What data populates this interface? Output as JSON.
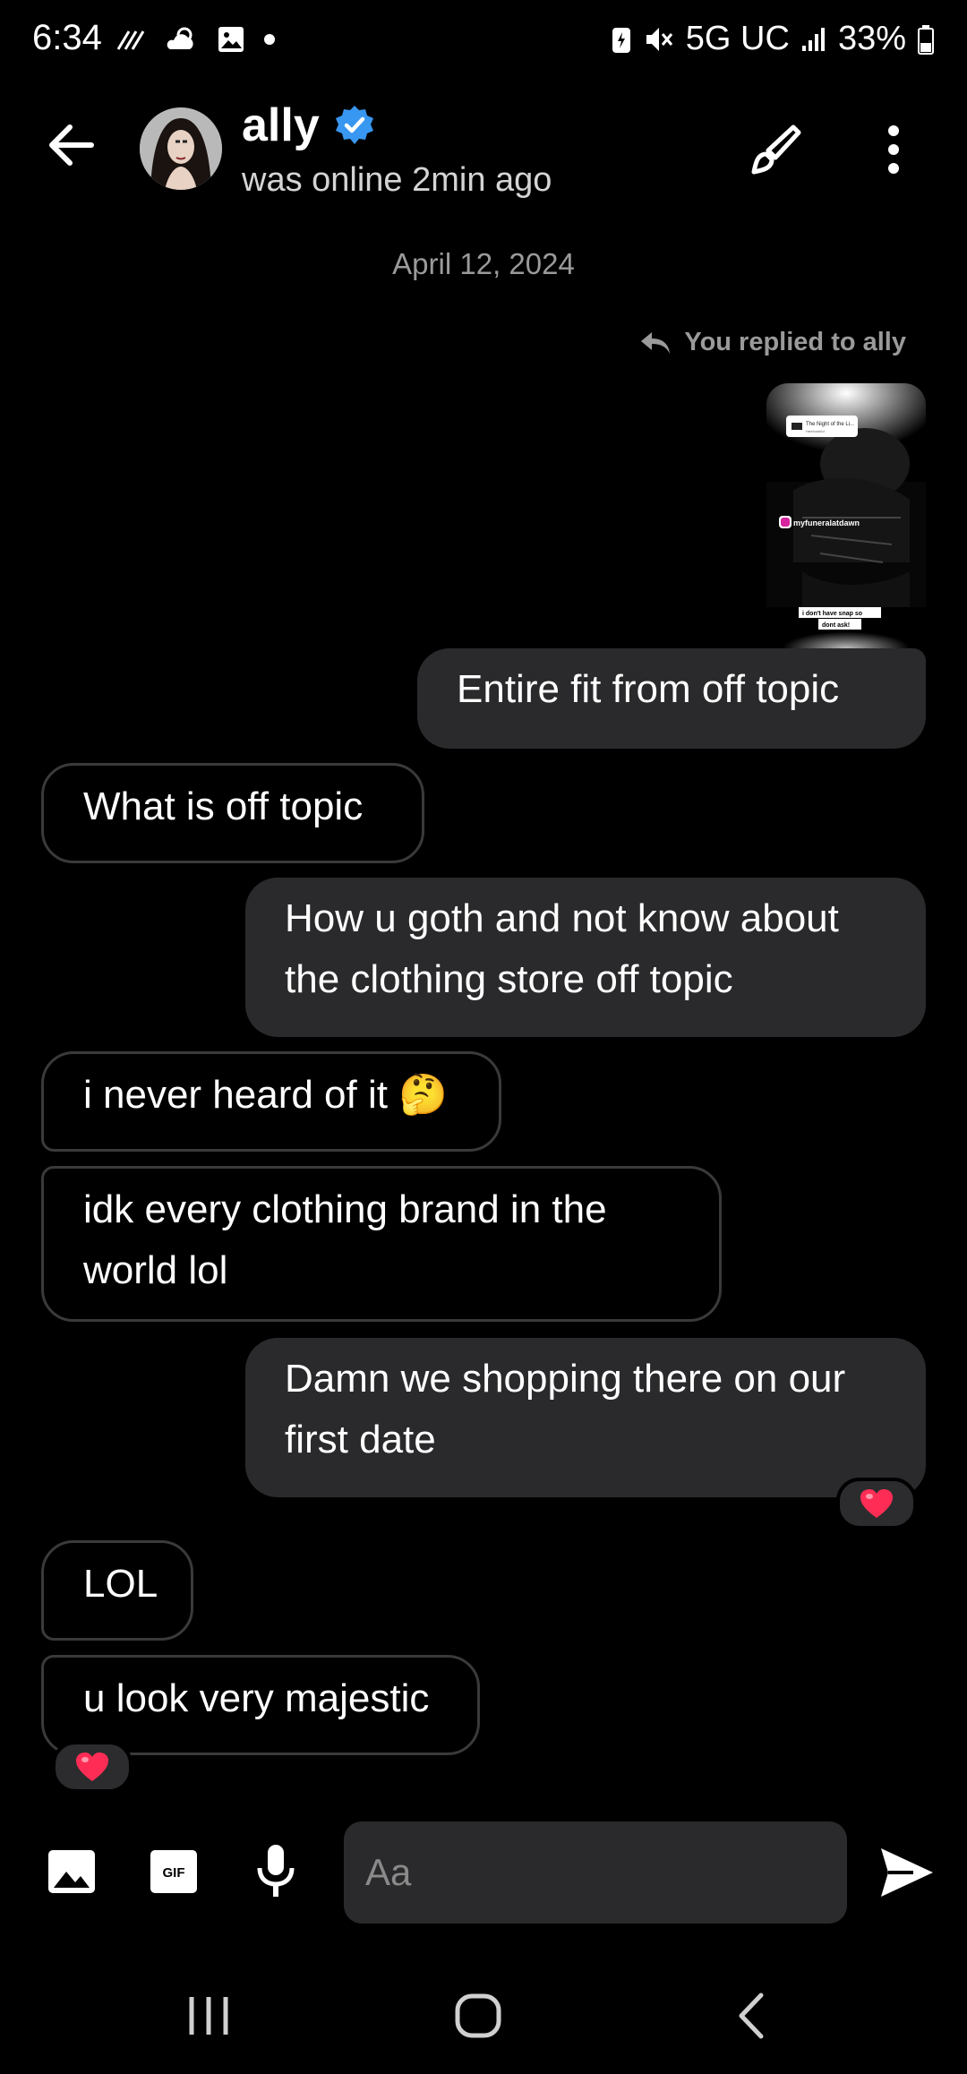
{
  "status_bar": {
    "time": "6:34",
    "network": "5G UC",
    "battery": "33%",
    "left_icons": [
      "signal-wave-icon",
      "weather-icon",
      "gallery-icon",
      "dot-icon"
    ],
    "right_icons": [
      "battery-saver-icon",
      "mute-icon",
      "signal-bars-icon",
      "battery-icon"
    ]
  },
  "header": {
    "name": "ally",
    "status": "was online 2min ago",
    "verified": true
  },
  "conversation": {
    "date": "April 12, 2024",
    "reply_note": "You replied to ally",
    "story": {
      "music_title": "The Night of the Li...",
      "music_artist": "Hemlockkid",
      "handle": "myfuneralatdawn",
      "caption_line1": "i don't have snap so",
      "caption_line2": "dont ask!"
    },
    "messages": [
      {
        "side": "sent",
        "text": "Entire fit from off topic"
      },
      {
        "side": "received",
        "text": "What is off topic"
      },
      {
        "side": "sent",
        "line1": "How u goth and not know about",
        "line2": "the clothing store off topic"
      },
      {
        "side": "received",
        "text": "i never heard of it 🤔"
      },
      {
        "side": "received",
        "line1": "idk every clothing brand in the",
        "line2": "world lol"
      },
      {
        "side": "sent",
        "line1": "Damn we shopping there on our",
        "line2": "first date",
        "reaction": "❤️"
      },
      {
        "side": "received",
        "text": "LOL"
      },
      {
        "side": "received",
        "text": "u look very majestic",
        "reaction": "❤️"
      }
    ]
  },
  "composer": {
    "placeholder": "Aa",
    "gif_label": "GIF",
    "icons": [
      "image-icon",
      "gif-icon",
      "mic-icon",
      "send-icon"
    ]
  },
  "colors": {
    "background": "#000000",
    "sent_bubble": "#2a2a2c",
    "received_border": "#3a3a3c",
    "verified": "#3897f0",
    "heart": "#ff2d55"
  }
}
